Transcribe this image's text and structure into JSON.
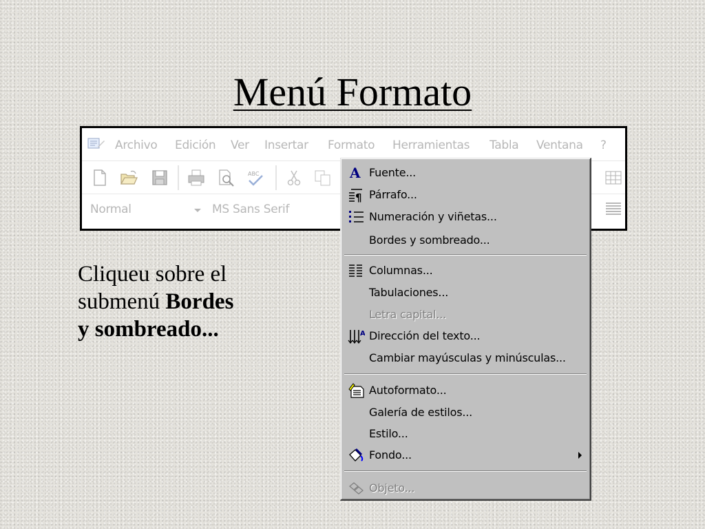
{
  "slide": {
    "title": "Menú Formato",
    "instruction": {
      "line1": "Cliqueu sobre el",
      "line2_plain": "submenú ",
      "line2_bold": "Bordes",
      "line3_bold": "y sombreado..."
    }
  },
  "menubar": {
    "items": [
      "Archivo",
      "Edición",
      "Ver",
      "Insertar",
      "Formato",
      "Herramientas",
      "Tabla",
      "Ventana",
      "?"
    ]
  },
  "toolbar": {
    "icons": [
      "new-document-icon",
      "open-folder-icon",
      "save-icon",
      "print-icon",
      "print-preview-icon",
      "spelling-icon",
      "cut-icon",
      "copy-icon"
    ]
  },
  "formatting_bar": {
    "style_value": "Normal",
    "font_value": "MS Sans Serif"
  },
  "format_menu": {
    "items": [
      {
        "label": "Fuente...",
        "icon": "font-icon",
        "enabled": true
      },
      {
        "label": "Párrafo...",
        "icon": "paragraph-icon",
        "enabled": true
      },
      {
        "label": "Numeración y viñetas...",
        "icon": "bullets-icon",
        "enabled": true
      },
      {
        "label": "Bordes y sombreado...",
        "icon": "",
        "enabled": true
      },
      {
        "label": "Columnas...",
        "icon": "columns-icon",
        "enabled": true
      },
      {
        "label": "Tabulaciones...",
        "icon": "",
        "enabled": true
      },
      {
        "label": "Letra capital...",
        "icon": "",
        "enabled": false
      },
      {
        "label": "Dirección del texto...",
        "icon": "text-direction-icon",
        "enabled": true
      },
      {
        "label": "Cambiar mayúsculas y minúsculas...",
        "icon": "",
        "enabled": true
      },
      {
        "label": "Autoformato...",
        "icon": "autoformat-icon",
        "enabled": true
      },
      {
        "label": "Galería de estilos...",
        "icon": "",
        "enabled": true
      },
      {
        "label": "Estilo...",
        "icon": "",
        "enabled": true
      },
      {
        "label": "Fondo...",
        "icon": "background-icon",
        "enabled": true,
        "submenu": true
      },
      {
        "label": "Objeto...",
        "icon": "object-icon",
        "enabled": false
      }
    ]
  }
}
